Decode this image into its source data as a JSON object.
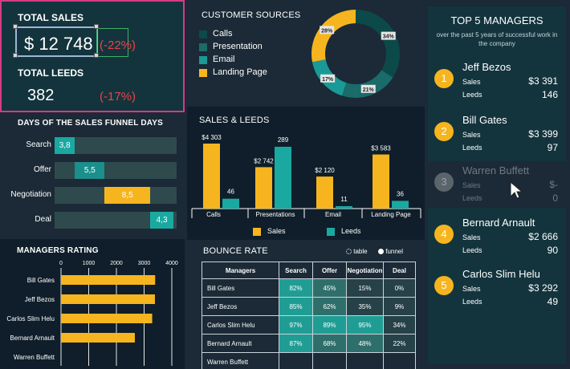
{
  "kpi": {
    "total_sales_label": "TOTAL SALES",
    "total_sales_value": "$ 12 748",
    "total_sales_change": "(-22%)",
    "total_leeds_label": "TOTAL LEEDS",
    "total_leeds_value": "382",
    "total_leeds_change": "(-17%)"
  },
  "funnel": {
    "title": "DAYS OF THE SALES FUNNEL DAYS",
    "rows": [
      {
        "label": "Search",
        "value": "3,8"
      },
      {
        "label": "Offer",
        "value": "5,5"
      },
      {
        "label": "Negotiation",
        "value": "8,5"
      },
      {
        "label": "Deal",
        "value": "4,3"
      }
    ]
  },
  "rating": {
    "title": "MANAGERS RATING"
  },
  "sources": {
    "title": "CUSTOMER SOURCES",
    "legend": [
      "Calls",
      "Presentation",
      "Email",
      "Landing Page"
    ]
  },
  "sales_chart": {
    "title": "SALES & LEEDS",
    "legend_sales": "Sales",
    "legend_leeds": "Leeds"
  },
  "bounce": {
    "title": "BOUNCE RATE",
    "toggle_table": "table",
    "toggle_funnel": "funnel",
    "headers": [
      "Managers",
      "Search",
      "Offer",
      "Negotiation",
      "Deal"
    ],
    "rows": [
      [
        "Bill Gates",
        "82%",
        "45%",
        "15%",
        "0%"
      ],
      [
        "Jeff Bezos",
        "85%",
        "62%",
        "35%",
        "9%"
      ],
      [
        "Carlos Slim Helu",
        "97%",
        "89%",
        "95%",
        "34%"
      ],
      [
        "Bernard Arnault",
        "87%",
        "68%",
        "48%",
        "22%"
      ],
      [
        "Warren Buffett",
        "",
        "",
        "",
        ""
      ]
    ]
  },
  "top5": {
    "title": "TOP 5 MANAGERS",
    "subtitle": "over the past 5 years of successful work in the company",
    "sales_label": "Sales",
    "leeds_label": "Leeds",
    "managers": [
      {
        "rank": "1",
        "name": "Jeff Bezos",
        "sales": "$3 391",
        "leeds": "146"
      },
      {
        "rank": "2",
        "name": "Bill Gates",
        "sales": "$3 399",
        "leeds": "97"
      },
      {
        "rank": "3",
        "name": "Warren Buffett",
        "sales": "$-",
        "leeds": "0"
      },
      {
        "rank": "4",
        "name": "Bernard Arnault",
        "sales": "$2 666",
        "leeds": "90"
      },
      {
        "rank": "5",
        "name": "Carlos Slim Helu",
        "sales": "$3 292",
        "leeds": "49"
      }
    ]
  },
  "colors": {
    "accent_yellow": "#f6b51e",
    "accent_teal": "#1aa9a1",
    "negative": "#e8434a",
    "highlight_border": "#d63b83"
  },
  "chart_data": [
    {
      "type": "bar",
      "title": "DAYS OF THE SALES FUNNEL DAYS",
      "categories": [
        "Search",
        "Offer",
        "Negotiation",
        "Deal"
      ],
      "values": [
        3.8,
        5.5,
        8.5,
        4.3
      ],
      "ranges": [
        [
          0,
          3.8
        ],
        [
          3.8,
          9.3
        ],
        [
          9.3,
          17.8
        ],
        [
          17.8,
          22.1
        ]
      ]
    },
    {
      "type": "bar",
      "title": "MANAGERS RATING",
      "categories": [
        "Bill Gates",
        "Jeff Bezos",
        "Carlos Slim Helu",
        "Bernard Arnault",
        "Warren Buffett"
      ],
      "values": [
        3399,
        3391,
        3292,
        2666,
        0
      ],
      "xlim": [
        0,
        4000
      ],
      "ticks": [
        "0",
        "1000",
        "2000",
        "3000",
        "4000"
      ]
    },
    {
      "type": "pie",
      "title": "CUSTOMER SOURCES",
      "labels": [
        "Calls",
        "Presentation",
        "Email",
        "Landing Page"
      ],
      "values": [
        34,
        21,
        17,
        28
      ],
      "value_labels": [
        "34%",
        "21%",
        "17%",
        "28%"
      ]
    },
    {
      "type": "bar",
      "title": "SALES & LEEDS",
      "categories": [
        "Calls",
        "Presentations",
        "Email",
        "Landing Page"
      ],
      "series": [
        {
          "name": "Sales",
          "values": [
            4303,
            2742,
            2120,
            3583
          ],
          "labels": [
            "$4 303",
            "$2 742",
            "$2 120",
            "$3 583"
          ]
        },
        {
          "name": "Leeds",
          "values": [
            46,
            289,
            11,
            36
          ],
          "labels": [
            "46",
            "289",
            "11",
            "36"
          ]
        }
      ]
    }
  ]
}
